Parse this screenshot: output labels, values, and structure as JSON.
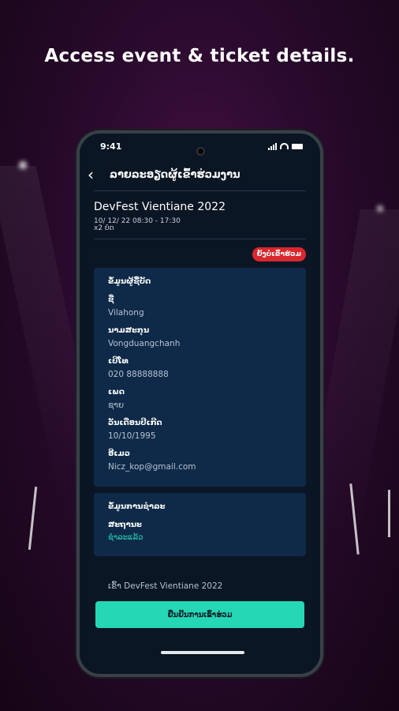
{
  "promo": {
    "headline": "Access event & ticket details."
  },
  "status_bar": {
    "time": "9:41"
  },
  "header": {
    "title": "ລາຍລະອຽດຜູ້ເຂົ້າຮ່ວມງານ"
  },
  "event": {
    "title": "DevFest Vientiane 2022",
    "datetime": "10/ 12/ 22  08:30 - 17:30",
    "extra": "x2 ບໍດ",
    "status_badge": "ຍັງບໍ່ເຂົ້າຮ່ວມ"
  },
  "attendee_card": {
    "title": "ຂໍ້ມູນຜູ້ຊື້ບັດ",
    "fields": [
      {
        "label": "ຊື່",
        "value": "Vilahong"
      },
      {
        "label": "ນາມສະກຸນ",
        "value": "Vongduangchanh"
      },
      {
        "label": "ເບີໂທ",
        "value": "020 88888888"
      },
      {
        "label": "ເພດ",
        "value": "ຊາຍ"
      },
      {
        "label": "ວັນເດືອນປີເກີດ",
        "value": "10/10/1995"
      },
      {
        "label": "ອີເມວ",
        "value": "Nicz_kop@gmail.com"
      }
    ]
  },
  "payment_card": {
    "title": "ຂໍ້ມູນການຊຳລະ",
    "status_label": "ສະຖານະ",
    "status_value": "ຊຳລະແລ້ວ"
  },
  "below_text": "ເຂົ້າ DevFest Vientiane 2022",
  "confirm_button": "ຢືນຢັນການເຂົ້າຮ່ວມ",
  "colors": {
    "accent": "#25d7b4",
    "badge": "#d8282e",
    "card": "#0f2a49"
  }
}
